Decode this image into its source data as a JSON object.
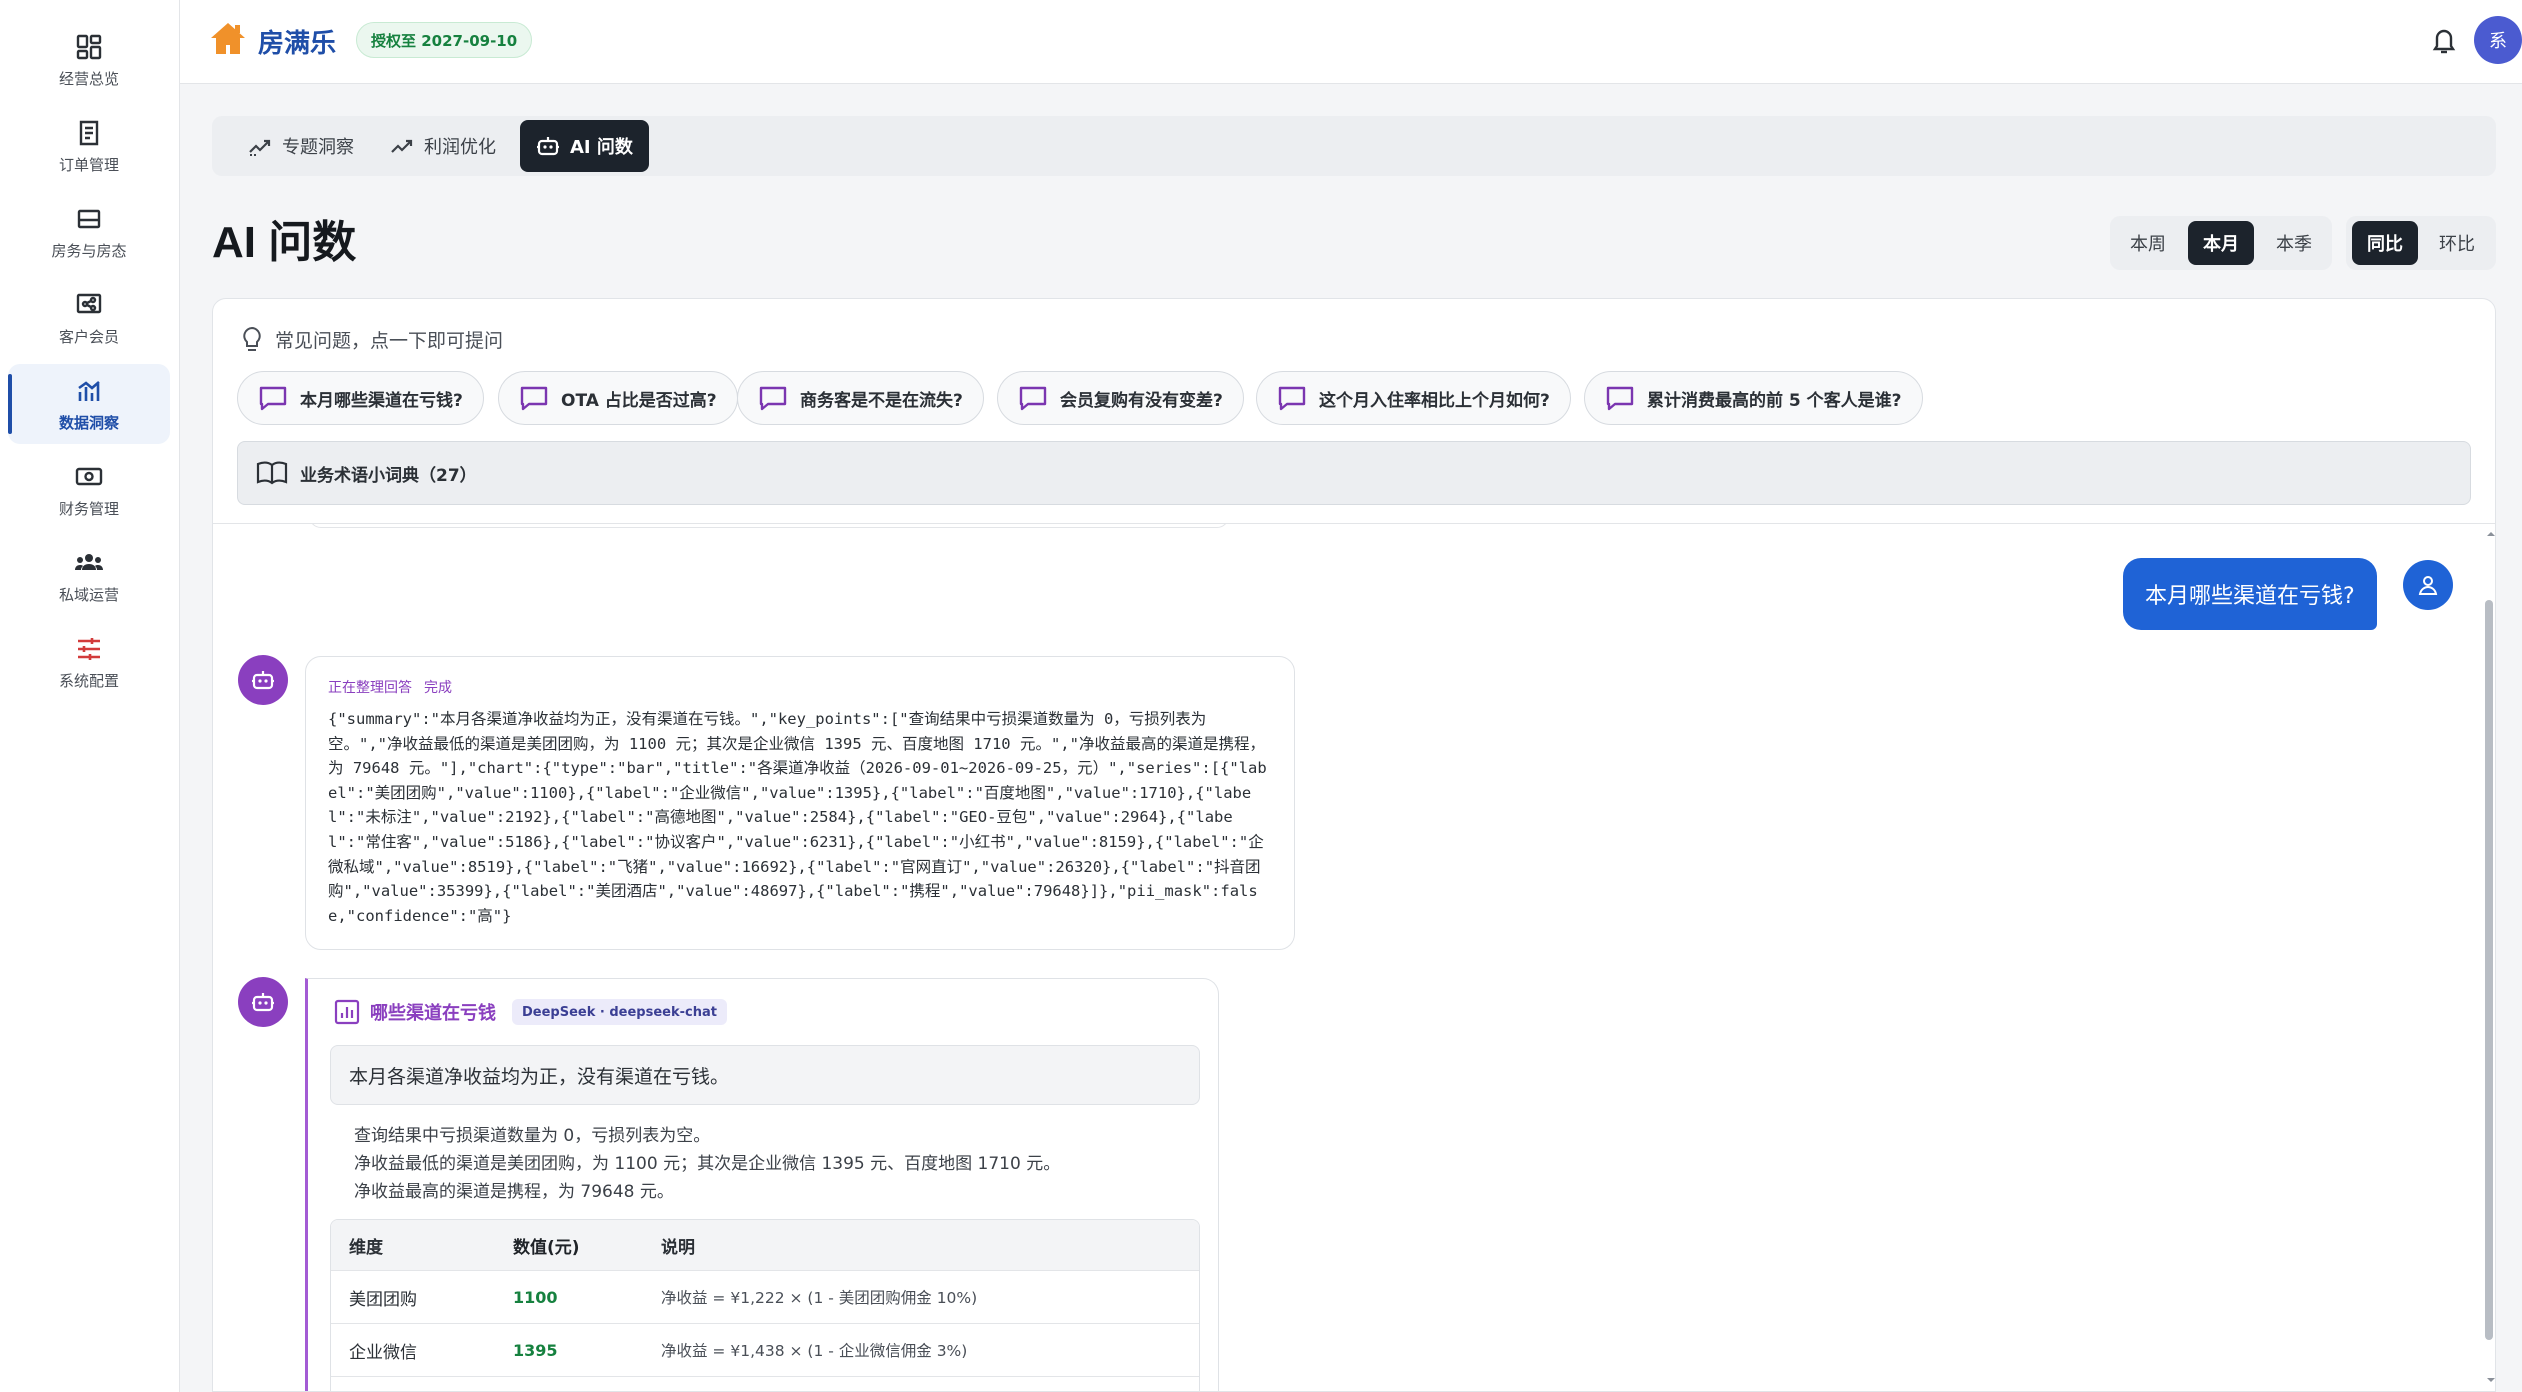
{
  "sidebar": {
    "items": [
      {
        "label": "经营总览",
        "icon": "dashboard-grid-icon"
      },
      {
        "label": "订单管理",
        "icon": "receipt-icon"
      },
      {
        "label": "房务与房态",
        "icon": "bed-icon"
      },
      {
        "label": "客户会员",
        "icon": "share-icon"
      },
      {
        "label": "数据洞察",
        "icon": "chart-icon"
      },
      {
        "label": "财务管理",
        "icon": "money-icon"
      },
      {
        "label": "私域运营",
        "icon": "group-icon"
      },
      {
        "label": "系统配置",
        "icon": "sliders-icon"
      }
    ],
    "active": "数据洞察"
  },
  "header": {
    "brand": "房满乐",
    "license": "授权至 2027-09-10",
    "avatar_text": "系"
  },
  "tabs": [
    "专题洞察",
    "利润优化",
    "AI 问数"
  ],
  "page_title": "AI 问数",
  "period": [
    "本周",
    "本月",
    "本季"
  ],
  "compare": [
    "同比",
    "环比"
  ],
  "faq": {
    "heading": "常见问题，点一下即可提问",
    "questions": [
      "本月哪些渠道在亏钱?",
      "OTA 占比是否过高?",
      "商务客是不是在流失?",
      "会员复购有没有变差?",
      "这个月入住率相比上个月如何?",
      "累计消费最高的前 5 个客人是谁?"
    ],
    "glossary": "业务术语小词典（27）"
  },
  "chat": {
    "user_message": "本月哪些渠道在亏钱?",
    "status": "正在整理回答",
    "status_done": "完成",
    "raw_json": "{\"summary\":\"本月各渠道净收益均为正，没有渠道在亏钱。\",\"key_points\":[\"查询结果中亏损渠道数量为 0，亏损列表为空。\",\"净收益最低的渠道是美团团购，为 1100 元；其次是企业微信 1395 元、百度地图 1710 元。\",\"净收益最高的渠道是携程，为 79648 元。\"],\"chart\":{\"type\":\"bar\",\"title\":\"各渠道净收益（2026-09-01~2026-09-25，元）\",\"series\":[{\"label\":\"美团团购\",\"value\":1100},{\"label\":\"企业微信\",\"value\":1395},{\"label\":\"百度地图\",\"value\":1710},{\"label\":\"未标注\",\"value\":2192},{\"label\":\"高德地图\",\"value\":2584},{\"label\":\"GEO-豆包\",\"value\":2964},{\"label\":\"常住客\",\"value\":5186},{\"label\":\"协议客户\",\"value\":6231},{\"label\":\"小红书\",\"value\":8159},{\"label\":\"企微私域\",\"value\":8519},{\"label\":\"飞猪\",\"value\":16692},{\"label\":\"官网直订\",\"value\":26320},{\"label\":\"抖音团购\",\"value\":35399},{\"label\":\"美团酒店\",\"value\":48697},{\"label\":\"携程\",\"value\":79648}]},\"pii_mask\":false,\"confidence\":\"高\"}",
    "answer": {
      "title": "哪些渠道在亏钱",
      "model": "DeepSeek · deepseek-chat",
      "summary": "本月各渠道净收益均为正，没有渠道在亏钱。",
      "key_points": [
        "查询结果中亏损渠道数量为 0，亏损列表为空。",
        "净收益最低的渠道是美团团购，为 1100 元；其次是企业微信 1395 元、百度地图 1710 元。",
        "净收益最高的渠道是携程，为 79648 元。"
      ],
      "table": {
        "headers": [
          "维度",
          "数值(元)",
          "说明"
        ],
        "rows": [
          [
            "美团团购",
            "1100",
            "净收益 = ¥1,222 × (1 - 美团团购佣金 10%)"
          ],
          [
            "企业微信",
            "1395",
            "净收益 = ¥1,438 × (1 - 企业微信佣金 3%)"
          ]
        ]
      }
    }
  },
  "colors": {
    "brand": "#1f4ea8",
    "user_bubble": "#1f63d6",
    "bot": "#8a3fbf",
    "positive": "#16813f"
  }
}
